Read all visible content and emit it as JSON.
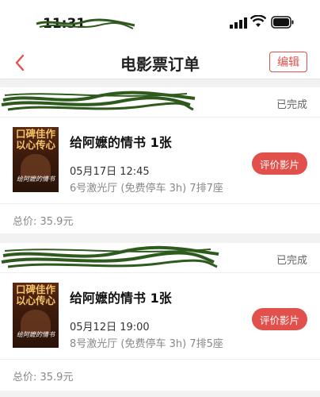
{
  "status_bar": {
    "time": "11:31"
  },
  "nav": {
    "title": "电影票订单",
    "edit_label": "编辑"
  },
  "orders": [
    {
      "status": "已完成",
      "poster_slogan_line1": "口碑佳作",
      "poster_slogan_line2": "以心传心",
      "poster_film_title": "给阿嬷的情书",
      "movie_title": "给阿嬷的情书 1张",
      "showtime": "05月17日 12:45",
      "hall": "6号激光厅 (免费停车 3h) 7排7座",
      "rate_label": "评价影片",
      "total": "总价: 35.9元"
    },
    {
      "status": "已完成",
      "poster_slogan_line1": "口碑佳作",
      "poster_slogan_line2": "以心传心",
      "poster_film_title": "给阿嬷的情书",
      "movie_title": "给阿嬷的情书 1张",
      "showtime": "05月12日 19:00",
      "hall": "8号激光厅 (免费停车 3h) 7排5座",
      "rate_label": "评价影片",
      "total": "总价: 35.9元"
    }
  ],
  "colors": {
    "accent": "#e2504c",
    "scribble": "#2f5a1e"
  },
  "icons": [
    "back-chevron-icon",
    "signal-icon",
    "wifi-icon",
    "battery-icon"
  ]
}
